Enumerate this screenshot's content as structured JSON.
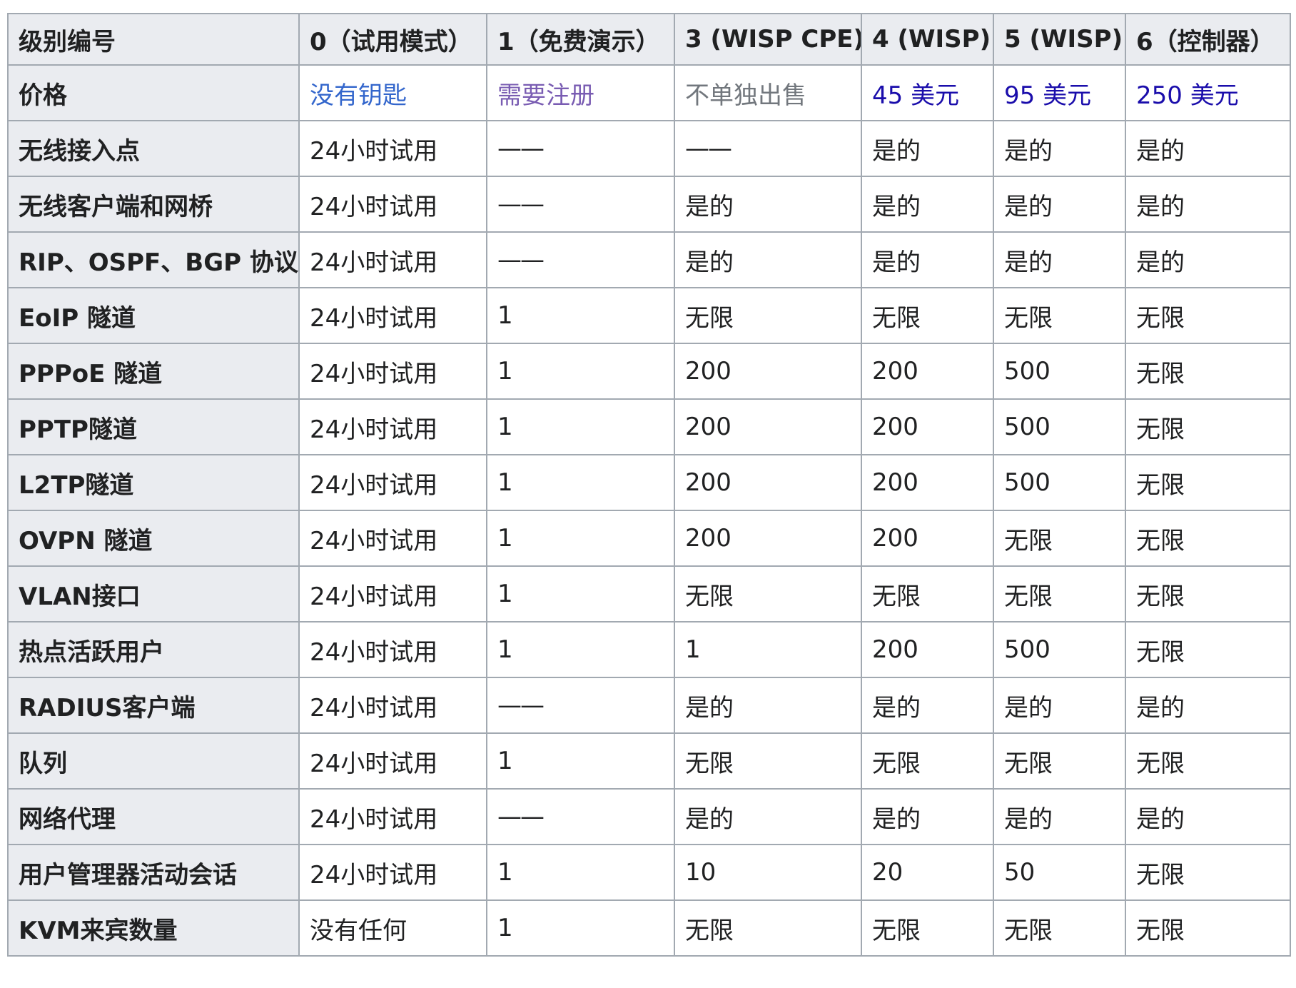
{
  "table": {
    "headers": [
      "级别编号",
      "0（试用模式）",
      "1（免费演示）",
      "3 (WISP CPE)",
      "4 (WISP)",
      "5 (WISP)",
      "6（控制器）"
    ],
    "price_row": {
      "label": "价格",
      "cells": [
        "没有钥匙",
        "需要注册",
        "不单独出售",
        "45 美元",
        "95 美元",
        "250 美元"
      ]
    },
    "rows": [
      {
        "label": "无线接入点",
        "cells": [
          "24小时试用",
          "——",
          "——",
          "是的",
          "是的",
          "是的"
        ]
      },
      {
        "label": "无线客户端和网桥",
        "cells": [
          "24小时试用",
          "——",
          "是的",
          "是的",
          "是的",
          "是的"
        ]
      },
      {
        "label": "RIP、OSPF、BGP 协议",
        "cells": [
          "24小时试用",
          "——",
          "是的",
          "是的",
          "是的",
          "是的"
        ]
      },
      {
        "label": "EoIP 隧道",
        "cells": [
          "24小时试用",
          "1",
          "无限",
          "无限",
          "无限",
          "无限"
        ]
      },
      {
        "label": "PPPoE 隧道",
        "cells": [
          "24小时试用",
          "1",
          "200",
          "200",
          "500",
          "无限"
        ]
      },
      {
        "label": "PPTP隧道",
        "cells": [
          "24小时试用",
          "1",
          "200",
          "200",
          "500",
          "无限"
        ]
      },
      {
        "label": "L2TP隧道",
        "cells": [
          "24小时试用",
          "1",
          "200",
          "200",
          "500",
          "无限"
        ]
      },
      {
        "label": "OVPN 隧道",
        "cells": [
          "24小时试用",
          "1",
          "200",
          "200",
          "无限",
          "无限"
        ]
      },
      {
        "label": "VLAN接口",
        "cells": [
          "24小时试用",
          "1",
          "无限",
          "无限",
          "无限",
          "无限"
        ]
      },
      {
        "label": "热点活跃用户",
        "cells": [
          "24小时试用",
          "1",
          "1",
          "200",
          "500",
          "无限"
        ]
      },
      {
        "label": "RADIUS客户端",
        "cells": [
          "24小时试用",
          "——",
          "是的",
          "是的",
          "是的",
          "是的"
        ]
      },
      {
        "label": "队列",
        "cells": [
          "24小时试用",
          "1",
          "无限",
          "无限",
          "无限",
          "无限"
        ]
      },
      {
        "label": "网络代理",
        "cells": [
          "24小时试用",
          "——",
          "是的",
          "是的",
          "是的",
          "是的"
        ]
      },
      {
        "label": "用户管理器活动会话",
        "cells": [
          "24小时试用",
          "1",
          "10",
          "20",
          "50",
          "无限"
        ]
      },
      {
        "label": "KVM来宾数量",
        "cells": [
          "没有任何",
          "1",
          "无限",
          "无限",
          "无限",
          "无限"
        ]
      }
    ]
  },
  "colors": {
    "border": "#a2a9b1",
    "header_bg": "#eaecf0",
    "text": "#202122",
    "link_blue": "#3366cc",
    "link_visited": "#795cb2",
    "link_new": "#1a0dab",
    "muted": "#72777d"
  }
}
